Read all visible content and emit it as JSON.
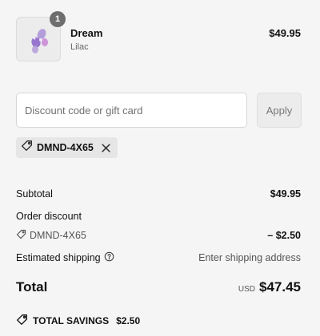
{
  "product": {
    "quantity": "1",
    "name": "Dream",
    "variant": "Lilac",
    "price": "$49.95"
  },
  "discount": {
    "placeholder": "Discount code or gift card",
    "apply_label": "Apply",
    "applied_code": "DMND-4X65"
  },
  "summary": {
    "subtotal_label": "Subtotal",
    "subtotal_value": "$49.95",
    "order_discount_label": "Order discount",
    "discount_code": "DMND-4X65",
    "discount_value": "– $2.50",
    "shipping_label": "Estimated shipping",
    "shipping_value": "Enter shipping address",
    "total_label": "Total",
    "currency": "USD",
    "total_value": "$47.45",
    "savings_label": "TOTAL SAVINGS",
    "savings_value": "$2.50"
  },
  "icons": {
    "tag": "tag-icon",
    "close": "close-icon",
    "help": "help-circle-icon"
  },
  "colors": {
    "background": "#f5f5f5",
    "badge": "#6e6e6e",
    "product_accent": "#9b7fd0"
  }
}
